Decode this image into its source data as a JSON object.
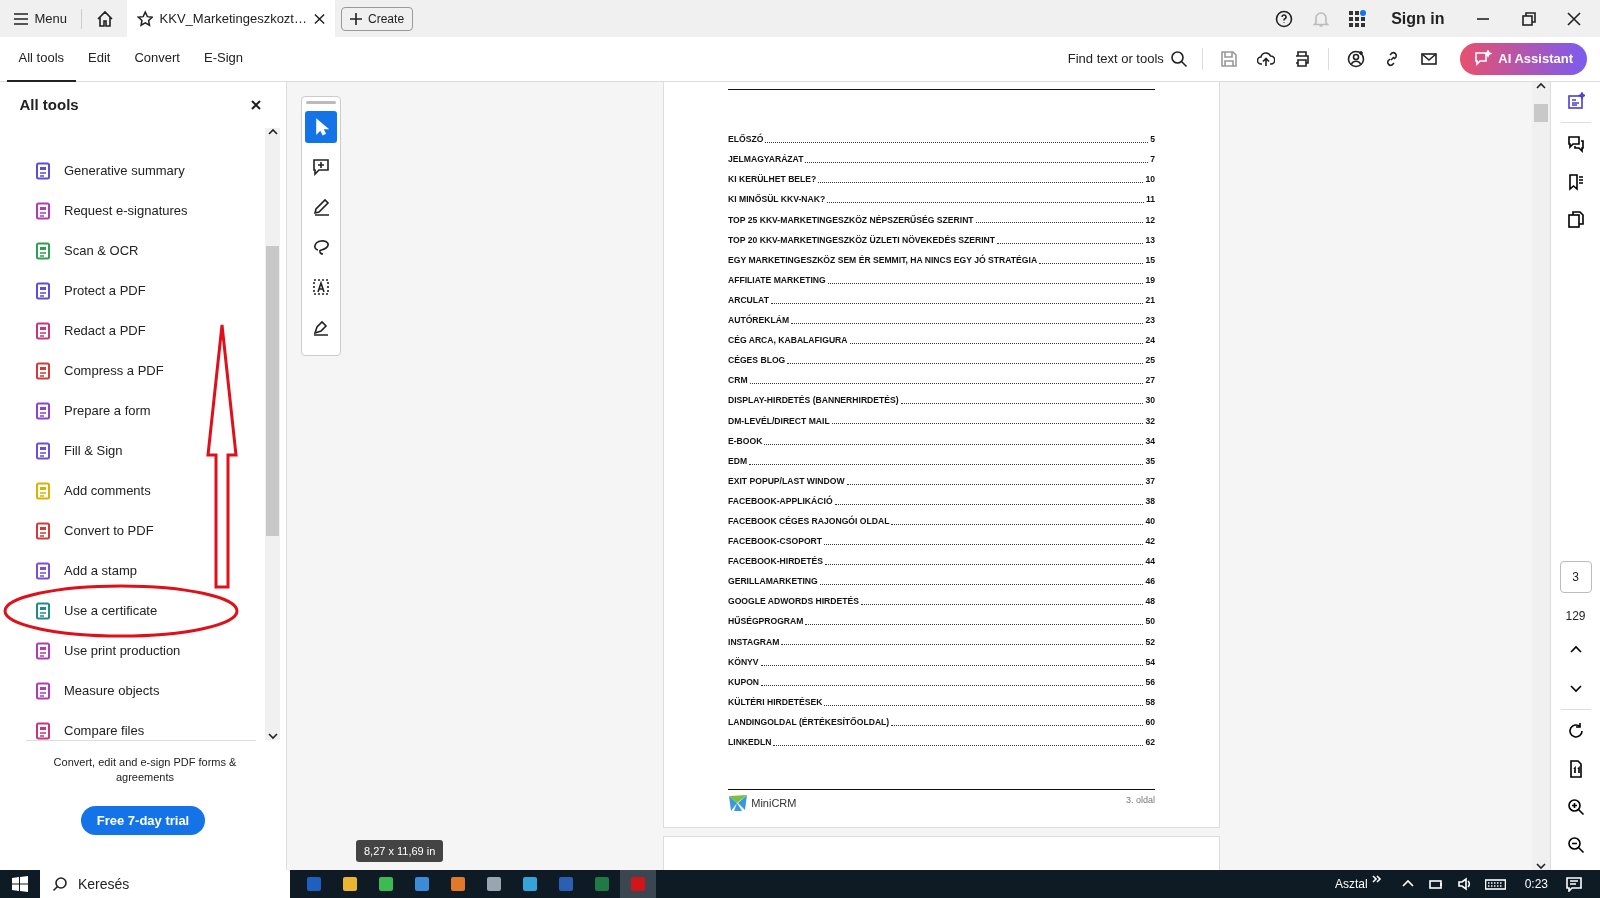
{
  "title_bar": {
    "menu": "Menu",
    "tab_title": "KKV_Marketingeszkozt…",
    "create": "Create",
    "sign_in": "Sign in"
  },
  "toolbar": {
    "tabs": [
      {
        "label": "All tools",
        "selected": true
      },
      {
        "label": "Edit",
        "selected": false
      },
      {
        "label": "Convert",
        "selected": false
      },
      {
        "label": "E-Sign",
        "selected": false
      }
    ],
    "find": "Find text or tools",
    "ai_button": "AI Assistant"
  },
  "panel": {
    "title": "All tools",
    "items": [
      {
        "label": "Generative summary",
        "color": "#5b4fd6",
        "selected": false
      },
      {
        "label": "Request e-signatures",
        "color": "#b03bb8",
        "selected": false
      },
      {
        "label": "Scan & OCR",
        "color": "#2e9e4f",
        "selected": false
      },
      {
        "label": "Protect a PDF",
        "color": "#5b4fd6",
        "selected": false
      },
      {
        "label": "Redact a PDF",
        "color": "#c8367a",
        "selected": false
      },
      {
        "label": "Compress a PDF",
        "color": "#d23a3a",
        "selected": false
      },
      {
        "label": "Prepare a form",
        "color": "#8e44c9",
        "selected": false
      },
      {
        "label": "Fill & Sign",
        "color": "#6b4fd6",
        "selected": false
      },
      {
        "label": "Add comments",
        "color": "#d9b300",
        "selected": false
      },
      {
        "label": "Convert to PDF",
        "color": "#d23a3a",
        "selected": false
      },
      {
        "label": "Add a stamp",
        "color": "#7a4fd6",
        "selected": false
      },
      {
        "label": "Use a certificate",
        "color": "#1f8a8a",
        "selected": false
      },
      {
        "label": "Use print production",
        "color": "#b03bb8",
        "selected": false
      },
      {
        "label": "Measure objects",
        "color": "#b03bb8",
        "selected": false
      },
      {
        "label": "Compare files",
        "color": "#c8367a",
        "selected": false
      }
    ],
    "promo": "Convert, edit and e-sign PDF forms & agreements",
    "trial": "Free 7-day trial"
  },
  "tools": [
    {
      "kind": "select",
      "selected": true
    },
    {
      "kind": "comment",
      "selected": false
    },
    {
      "kind": "pen",
      "selected": false
    },
    {
      "kind": "lasso",
      "selected": false
    },
    {
      "kind": "text",
      "selected": false
    },
    {
      "kind": "sign",
      "selected": false
    }
  ],
  "document": {
    "toc": [
      {
        "title": "ELŐSZÓ",
        "page": "5"
      },
      {
        "title": "JELMAGYARÁZAT",
        "page": "7"
      },
      {
        "title": "KI KERÜLHET BELE?",
        "page": "10"
      },
      {
        "title": "KI MINŐSÜL KKV-NAK?",
        "page": "11"
      },
      {
        "title": "TOP 25 KKV-MARKETINGESZKÖZ NÉPSZERŰSÉG SZERINT",
        "page": "12"
      },
      {
        "title": "TOP 20 KKV-MARKETINGESZKÖZ ÜZLETI NÖVEKEDÉS SZERINT",
        "page": "13"
      },
      {
        "title": "EGY MARKETINGESZKÖZ SEM ÉR SEMMIT, HA NINCS EGY JÓ STRATÉGIA",
        "page": "15"
      },
      {
        "title": "AFFILIATE MARKETING",
        "page": "19"
      },
      {
        "title": "ARCULAT",
        "page": "21"
      },
      {
        "title": "AUTÓREKLÁM",
        "page": "23"
      },
      {
        "title": "CÉG ARCA, KABALAFIGURA",
        "page": "24"
      },
      {
        "title": "CÉGES BLOG",
        "page": "25"
      },
      {
        "title": "CRM",
        "page": "27"
      },
      {
        "title": "DISPLAY-HIRDETÉS (BANNERHIRDETÉS)",
        "page": "30"
      },
      {
        "title": "DM-LEVÉL/DIRECT MAIL",
        "page": "32"
      },
      {
        "title": "E-BOOK",
        "page": "34"
      },
      {
        "title": "EDM",
        "page": "35"
      },
      {
        "title": "EXIT POPUP/LAST WINDOW",
        "page": "37"
      },
      {
        "title": "FACEBOOK-APPLIKÁCIÓ",
        "page": "38"
      },
      {
        "title": "FACEBOOK CÉGES RAJONGÓI OLDAL",
        "page": "40"
      },
      {
        "title": "FACEBOOK-CSOPORT",
        "page": "42"
      },
      {
        "title": "FACEBOOK-HIRDETÉS",
        "page": "44"
      },
      {
        "title": "GERILLAMARKETING",
        "page": "46"
      },
      {
        "title": "GOOGLE ADWORDS HIRDETÉS",
        "page": "48"
      },
      {
        "title": "HŰSÉGPROGRAM",
        "page": "50"
      },
      {
        "title": "INSTAGRAM",
        "page": "52"
      },
      {
        "title": "KÖNYV",
        "page": "54"
      },
      {
        "title": "KUPON",
        "page": "56"
      },
      {
        "title": "KÜLTÉRI HIRDETÉSEK",
        "page": "58"
      },
      {
        "title": "LANDINGOLDAL (ÉRTÉKESÍTŐOLDAL)",
        "page": "60"
      },
      {
        "title": "LINKEDLN",
        "page": "62"
      }
    ],
    "logo_text": "MiniCRM",
    "page_label": "3. oldal"
  },
  "page_size": "8,27 x 11,69 in",
  "page_nav": {
    "current": "3",
    "total": "129"
  },
  "taskbar": {
    "search": "Keresés",
    "desktop": "Asztal",
    "time": "0:23"
  }
}
